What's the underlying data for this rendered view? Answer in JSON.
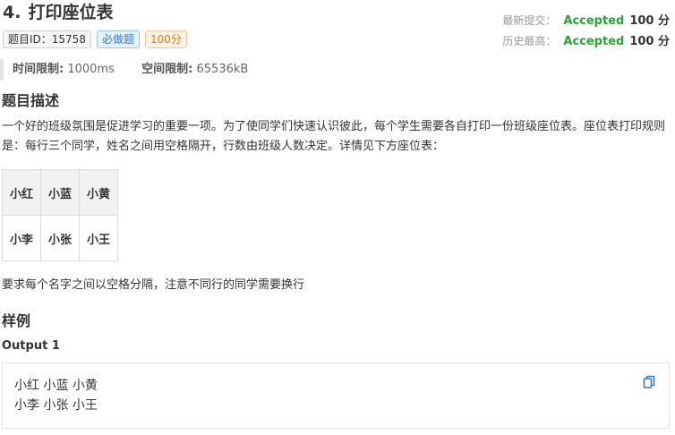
{
  "problem": {
    "number": "4.",
    "title": "打印座位表",
    "tags": [
      "题目ID：15758",
      "必做题",
      "100分"
    ]
  },
  "status": {
    "latest_label": "最新提交：",
    "latest_result": "Accepted",
    "latest_score": "100 分",
    "best_label": "历史最高：",
    "best_result": "Accepted",
    "best_score": "100 分"
  },
  "limits": {
    "time_label": "时间限制:",
    "time_value": "1000ms",
    "memory_label": "空间限制:",
    "memory_value": "65536kB"
  },
  "description": {
    "heading": "题目描述",
    "text": "一个好的班级氛围是促进学习的重要一项。为了使同学们快速认识彼此，每个学生需要各自打印一份班级座位表。座位表打印规则是：每行三个同学，姓名之间用空格隔开，行数由班级人数决定。详情见下方座位表：",
    "seats": [
      [
        "小红",
        "小蓝",
        "小黄"
      ],
      [
        "小李",
        "小张",
        "小王"
      ]
    ],
    "note": "要求每个名字之间以空格分隔，注意不同行的同学需要换行"
  },
  "example": {
    "heading": "样例",
    "output_label": "Output 1",
    "output_text": "小红 小蓝 小黄\n小李 小张 小王"
  },
  "colors": {
    "accepted": "#2aa336",
    "icon": "#2f7bbf"
  },
  "icons": {
    "copy": "copy-icon"
  }
}
